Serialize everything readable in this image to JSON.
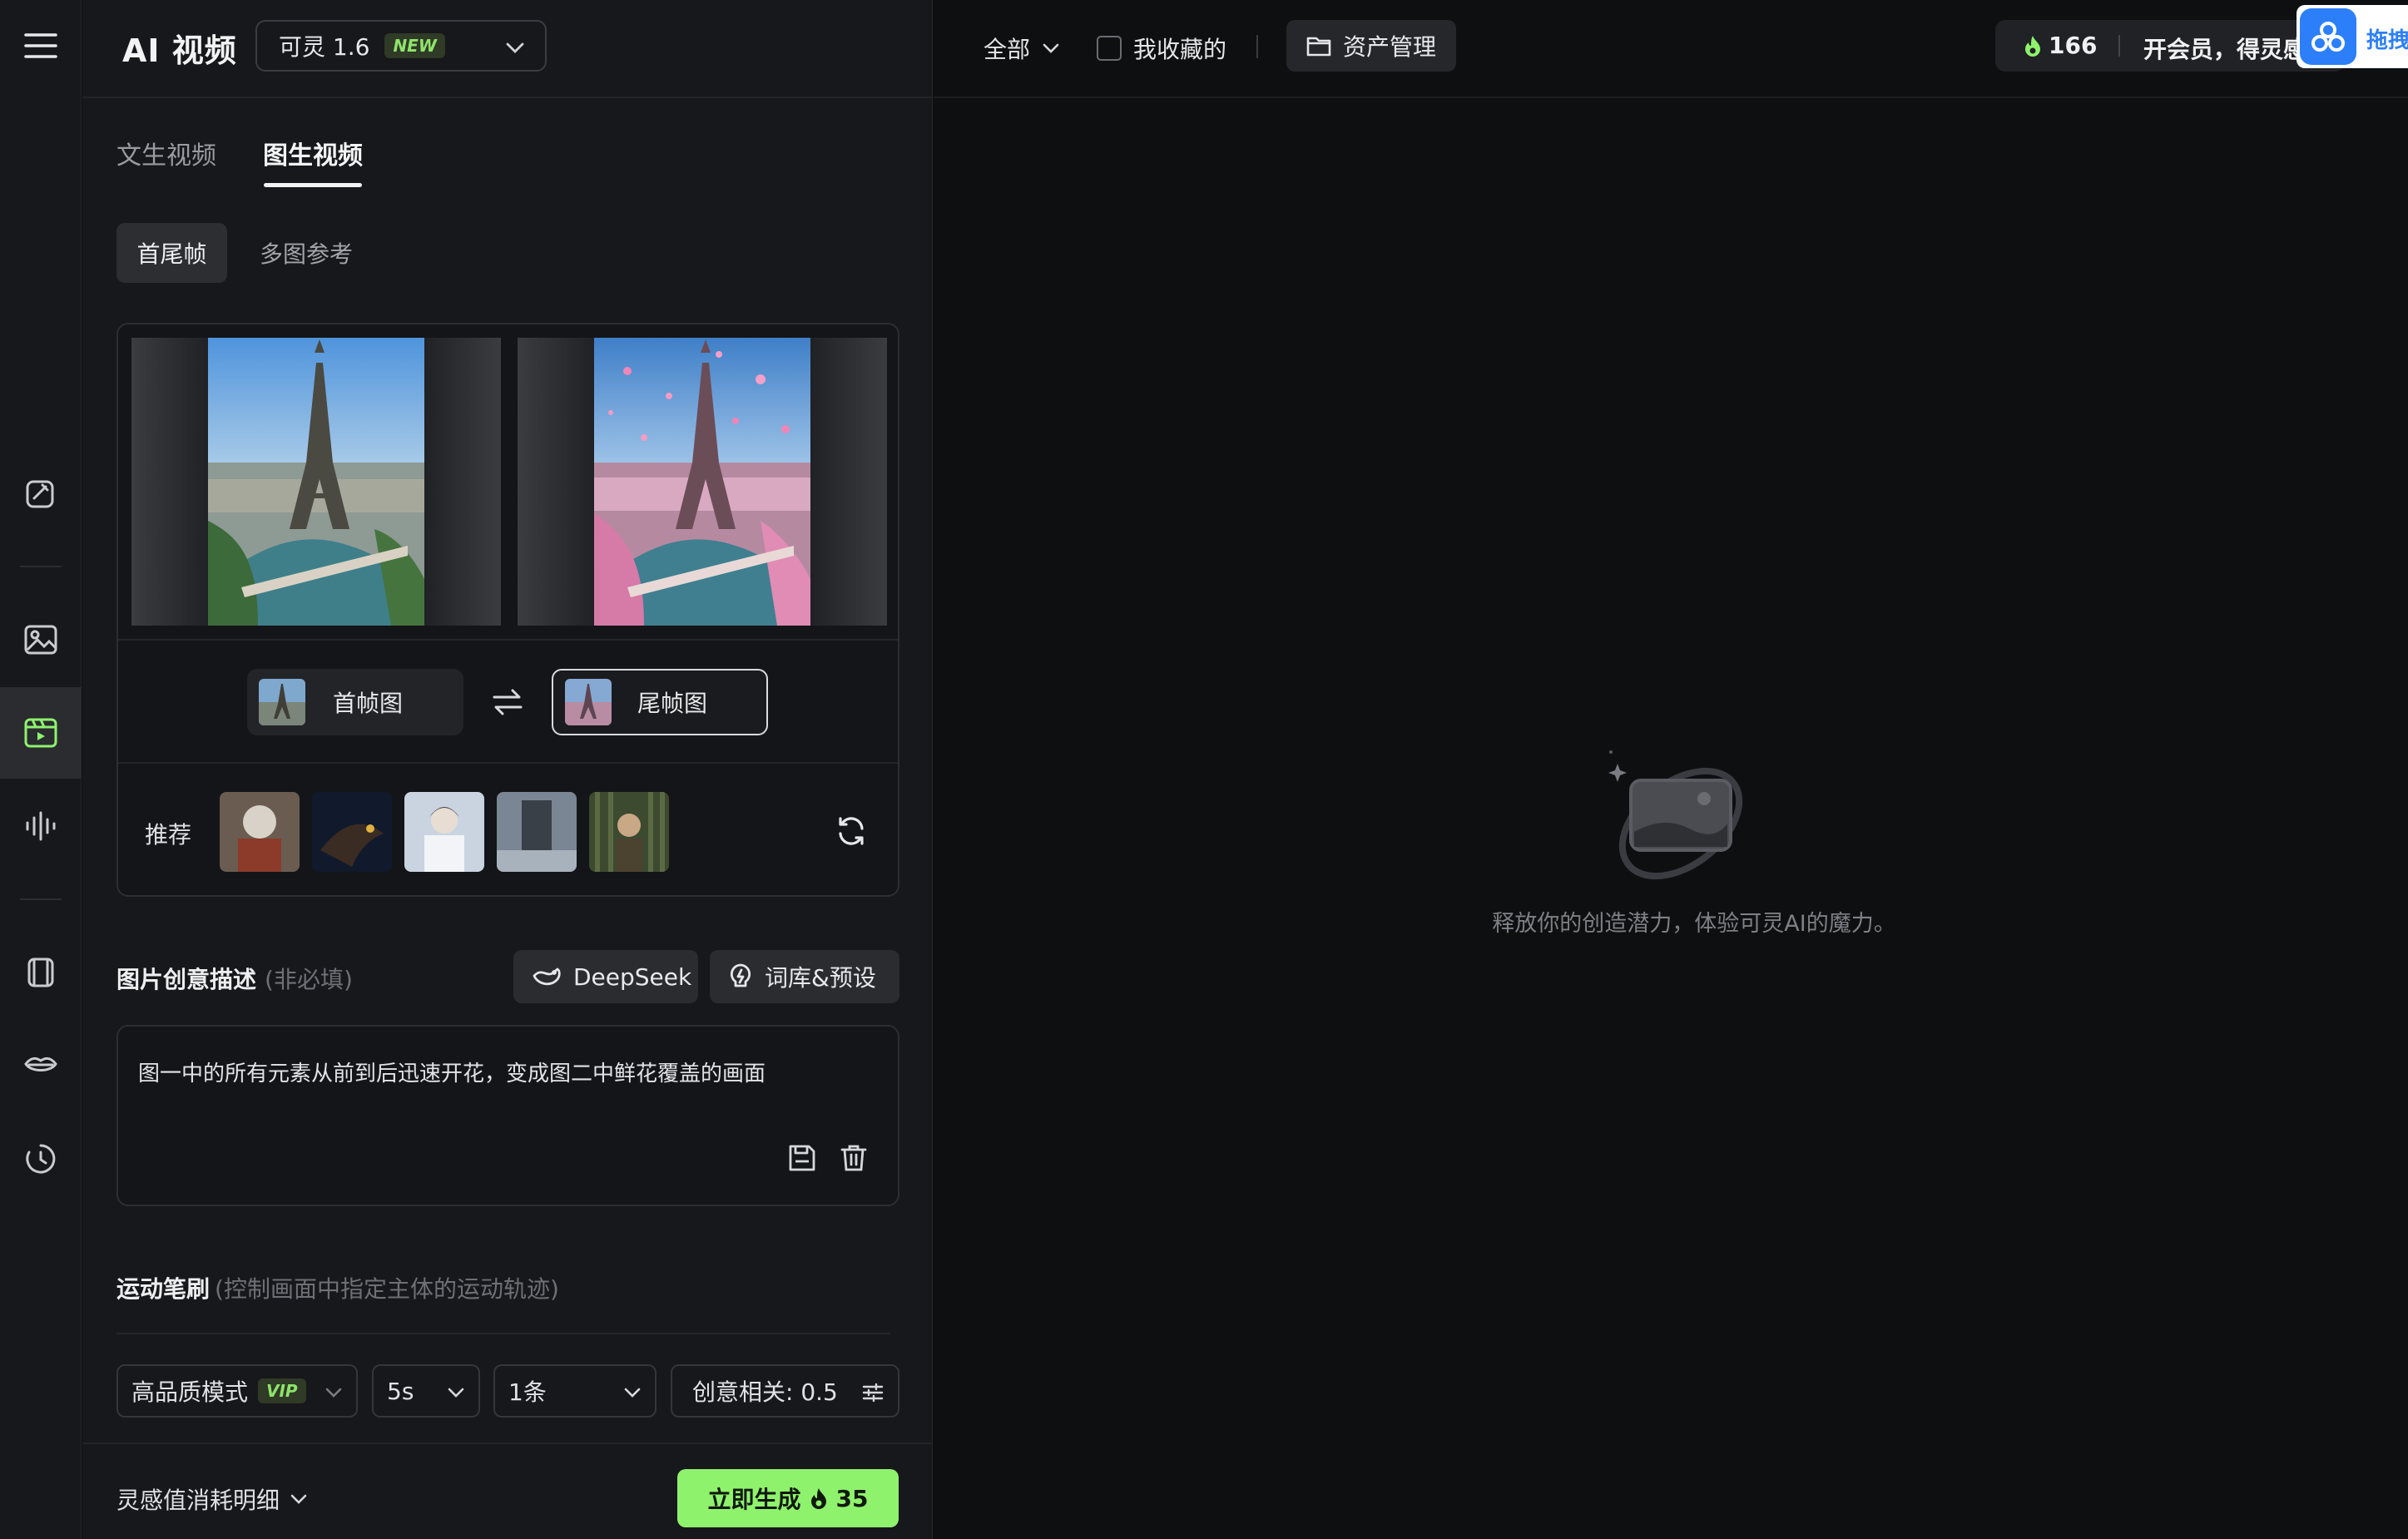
{
  "header": {
    "title": "AI 视频",
    "model_name": "可灵 1.6",
    "model_badge": "NEW"
  },
  "tabs": [
    {
      "label": "文生视频",
      "active": false
    },
    {
      "label": "图生视频",
      "active": true
    }
  ],
  "subtabs": [
    {
      "label": "首尾帧",
      "active": true
    },
    {
      "label": "多图参考",
      "active": false
    }
  ],
  "frames": {
    "first_label": "首帧图",
    "last_label": "尾帧图",
    "selected": "last"
  },
  "recommend": {
    "label": "推荐",
    "thumbnails": [
      "warrior-cat",
      "eagle",
      "white-haired-figure",
      "giant-monolith",
      "forest-soldier"
    ]
  },
  "prompt": {
    "title": "图片创意描述",
    "hint": "(非必填)",
    "deepseek_label": "DeepSeek",
    "library_label": "词库&预设",
    "text": "图一中的所有元素从前到后迅速开花，变成图二中鲜花覆盖的画面"
  },
  "motion_brush": {
    "title": "运动笔刷",
    "hint": "(控制画面中指定主体的运动轨迹)"
  },
  "options": {
    "mode": "高品质模式",
    "mode_badge": "VIP",
    "duration": "5s",
    "count": "1条",
    "creativity": "创意相关: 0.5"
  },
  "footer": {
    "consume_label": "灵感值消耗明细",
    "generate_label": "立即生成",
    "generate_cost": "35"
  },
  "topbar": {
    "filter_label": "全部",
    "favorites_label": "我收藏的",
    "asset_label": "资产管理",
    "credits": "166",
    "vip_label": "开会员，得灵感",
    "widget_label": "拖拽"
  },
  "empty_state": {
    "text": "释放你的创造潜力，体验可灵AI的魔力。"
  },
  "colors": {
    "accent_green": "#8ff26d",
    "background": "#0e0f11",
    "panel": "#17181b"
  }
}
